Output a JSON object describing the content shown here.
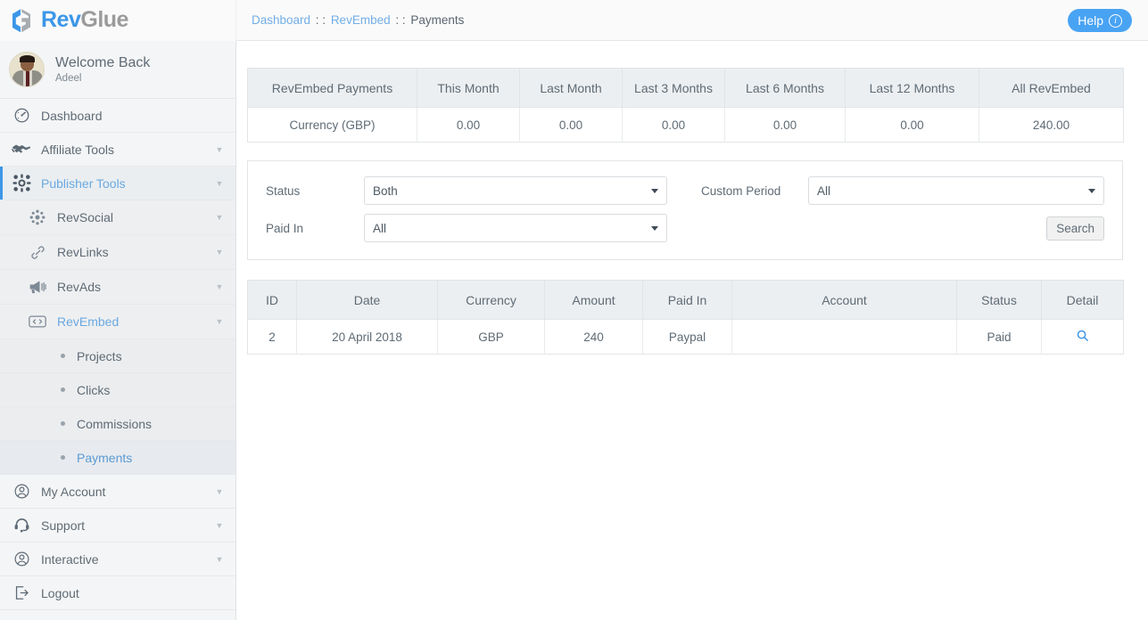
{
  "brand": {
    "rev": "Rev",
    "glue": "Glue",
    "logo_icon": "revglue-cube-logo"
  },
  "header": {
    "breadcrumb": [
      {
        "label": "Dashboard",
        "link": true
      },
      {
        "label": "RevEmbed",
        "link": true
      },
      {
        "label": "Payments",
        "link": false
      }
    ],
    "separator": " : : ",
    "help_label": "Help",
    "help_icon": "info-circle-icon"
  },
  "profile": {
    "welcome": "Welcome Back",
    "name": "Adeel",
    "avatar_icon": "user-photo-avatar"
  },
  "sidebar": {
    "items": [
      {
        "label": "Dashboard",
        "icon": "speedometer-icon",
        "caret": false,
        "level": 0,
        "active": false
      },
      {
        "label": "Affiliate Tools",
        "icon": "handshake-icon",
        "caret": true,
        "level": 0,
        "active": false
      },
      {
        "label": "Publisher Tools",
        "icon": "puzzle-gear-icon",
        "caret": true,
        "level": 0,
        "active": true
      },
      {
        "label": "RevSocial",
        "icon": "network-nodes-icon",
        "caret": true,
        "level": 1,
        "active": false
      },
      {
        "label": "RevLinks",
        "icon": "chain-link-icon",
        "caret": true,
        "level": 1,
        "active": false
      },
      {
        "label": "RevAds",
        "icon": "megaphone-icon",
        "caret": true,
        "level": 1,
        "active": false
      },
      {
        "label": "RevEmbed",
        "icon": "code-brackets-icon",
        "caret": true,
        "level": 1,
        "active": true
      },
      {
        "label": "Projects",
        "icon": "bullet-icon",
        "caret": false,
        "level": 2,
        "active": false
      },
      {
        "label": "Clicks",
        "icon": "bullet-icon",
        "caret": false,
        "level": 2,
        "active": false
      },
      {
        "label": "Commissions",
        "icon": "bullet-icon",
        "caret": false,
        "level": 2,
        "active": false
      },
      {
        "label": "Payments",
        "icon": "bullet-icon",
        "caret": false,
        "level": 2,
        "active": true
      },
      {
        "label": "My Account",
        "icon": "user-circle-icon",
        "caret": true,
        "level": 0,
        "active": false
      },
      {
        "label": "Support",
        "icon": "headset-icon",
        "caret": true,
        "level": 0,
        "active": false
      },
      {
        "label": "Interactive",
        "icon": "user-circle-icon",
        "caret": true,
        "level": 0,
        "active": false
      },
      {
        "label": "Logout",
        "icon": "logout-arrow-icon",
        "caret": false,
        "level": 0,
        "active": false
      }
    ]
  },
  "summary_table": {
    "headers": [
      "RevEmbed Payments",
      "This Month",
      "Last Month",
      "Last 3 Months",
      "Last 6 Months",
      "Last 12 Months",
      "All RevEmbed"
    ],
    "rows": [
      [
        "Currency (GBP)",
        "0.00",
        "0.00",
        "0.00",
        "0.00",
        "0.00",
        "240.00"
      ]
    ]
  },
  "filters": {
    "status": {
      "label": "Status",
      "value": "Both"
    },
    "paid_in": {
      "label": "Paid In",
      "value": "All"
    },
    "custom_period": {
      "label": "Custom Period",
      "value": "All"
    },
    "search_label": "Search"
  },
  "results_table": {
    "headers": [
      "ID",
      "Date",
      "Currency",
      "Amount",
      "Paid In",
      "Account",
      "Status",
      "Detail"
    ],
    "rows": [
      {
        "id": "2",
        "date": "20 April 2018",
        "currency": "GBP",
        "amount": "240",
        "paid_in": "Paypal",
        "account": "",
        "status": "Paid",
        "detail_icon": "magnifier-search-icon"
      }
    ]
  },
  "colors": {
    "accent": "#3c97e8",
    "help_button": "#49a3f3",
    "sidebar_bg": "#f4f5f6",
    "table_header_bg": "#eceff1",
    "text": "#5f6b75"
  }
}
